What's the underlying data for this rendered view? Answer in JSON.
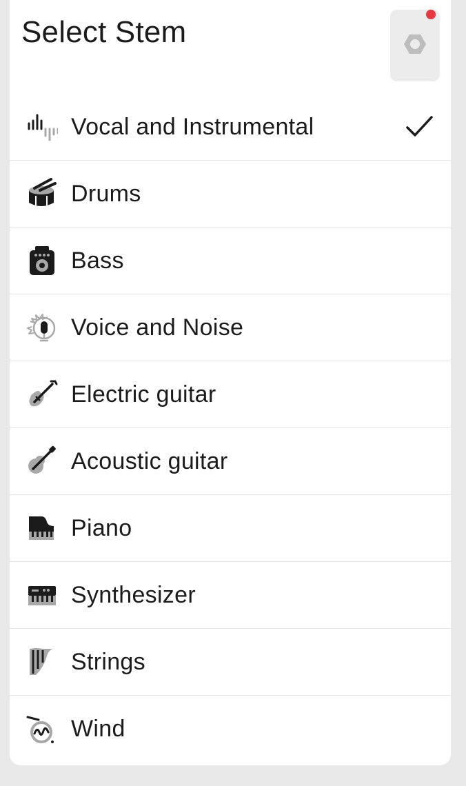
{
  "header": {
    "title": "Select Stem",
    "settings_icon": "gear-icon",
    "notification_color": "#e8383f"
  },
  "stems": [
    {
      "label": "Vocal and Instrumental",
      "icon": "waveform-split-icon",
      "selected": true
    },
    {
      "label": "Drums",
      "icon": "drum-icon",
      "selected": false
    },
    {
      "label": "Bass",
      "icon": "bass-amp-icon",
      "selected": false
    },
    {
      "label": "Voice and Noise",
      "icon": "microphone-noise-icon",
      "selected": false
    },
    {
      "label": "Electric guitar",
      "icon": "electric-guitar-icon",
      "selected": false
    },
    {
      "label": "Acoustic guitar",
      "icon": "acoustic-guitar-icon",
      "selected": false
    },
    {
      "label": "Piano",
      "icon": "grand-piano-icon",
      "selected": false
    },
    {
      "label": "Synthesizer",
      "icon": "synthesizer-icon",
      "selected": false
    },
    {
      "label": "Strings",
      "icon": "harp-icon",
      "selected": false
    },
    {
      "label": "Wind",
      "icon": "french-horn-icon",
      "selected": false
    }
  ],
  "selected_check_icon": "checkmark-icon"
}
